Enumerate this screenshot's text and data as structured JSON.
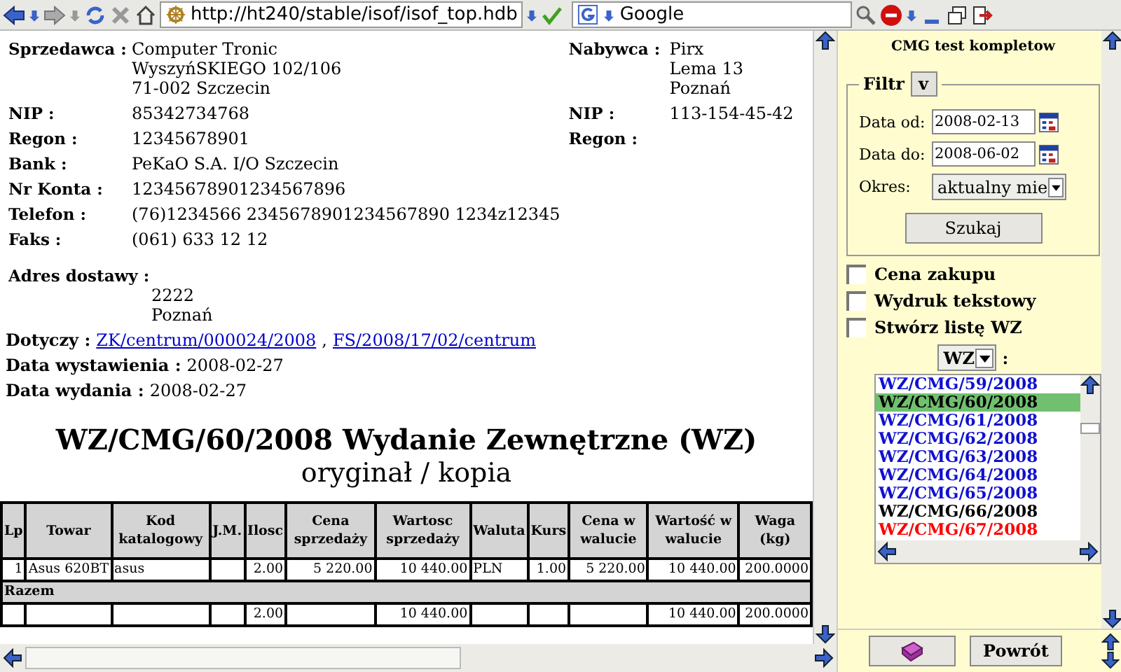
{
  "toolbar": {
    "url": "http://ht240/stable/isof/isof_top.hdb",
    "search": "Google"
  },
  "seller": {
    "label": "Sprzedawca :",
    "lines": [
      "Computer Tronic",
      "WyszyńSKIEGO 102/106",
      "71-002 Szczecin"
    ]
  },
  "buyer": {
    "label": "Nabywca :",
    "lines": [
      "Pirx",
      "Lema 13",
      "Poznań"
    ]
  },
  "seller_details": [
    {
      "label": "NIP :",
      "value": "85342734768"
    },
    {
      "label": "Regon :",
      "value": "12345678901"
    },
    {
      "label": "Bank :",
      "value": "PeKaO S.A. I/O Szczecin"
    },
    {
      "label": "Nr Konta :",
      "value": "12345678901234567896"
    },
    {
      "label": "Telefon :",
      "value": "(76)1234566 2345678901234567890 1234z12345"
    },
    {
      "label": "Faks :",
      "value": "(061) 633 12 12"
    }
  ],
  "buyer_details": [
    {
      "label": "NIP :",
      "value": "113-154-45-42"
    },
    {
      "label": "Regon :"
    }
  ],
  "delivery": {
    "label": "Adres dostawy :",
    "lines": [
      "2222",
      "Poznań"
    ]
  },
  "related": {
    "label": "Dotyczy :",
    "links": [
      "ZK/centrum/000024/2008",
      "FS/2008/17/02/centrum"
    ],
    "separator": ","
  },
  "dates": [
    {
      "label": "Data wystawienia :",
      "value": "2008-02-27"
    },
    {
      "label": "Data wydania :",
      "value": "2008-02-27"
    }
  ],
  "title": "WZ/CMG/60/2008 Wydanie Zewnętrzne (WZ)",
  "subtitle": "oryginał / kopia",
  "table": {
    "columns": [
      "Lp",
      "Towar",
      "Kod katalogowy",
      "J.M.",
      "Ilosc",
      "Cena sprzedaży",
      "Wartosc sprzedaży",
      "Waluta",
      "Kurs",
      "Cena w walucie",
      "Wartość w walucie",
      "Waga (kg)"
    ],
    "rows": [
      [
        "1",
        "Asus 620BT",
        "asus",
        "",
        "2.00",
        "5 220.00",
        "10 440.00",
        "PLN",
        "1.00",
        "5 220.00",
        "10 440.00",
        "200.0000"
      ]
    ],
    "total_label": "Razem",
    "total": {
      "quantity": "2.00",
      "sale_value": "10 440.00",
      "currency_value": "10 440.00",
      "weight": "200.0000"
    }
  },
  "sidebar": {
    "title": "CMG test kompletow",
    "filter": {
      "legend": "Filtr",
      "toggle": "v",
      "date_from": {
        "label": "Data od:",
        "value": "2008-02-13"
      },
      "date_to": {
        "label": "Data do:",
        "value": "2008-06-02"
      },
      "period": {
        "label": "Okres:",
        "value": "aktualny mie"
      },
      "search_button": "Szukaj"
    },
    "checkboxes": [
      {
        "label": "Cena zakupu",
        "checked": false
      },
      {
        "label": "Wydruk tekstowy",
        "checked": false
      },
      {
        "label": "Stwórz listę WZ",
        "checked": false
      }
    ],
    "doc_type": {
      "value": "WZ",
      "suffix": ":"
    },
    "documents": [
      {
        "label": "WZ/CMG/59/2008",
        "color": "#1010d0",
        "selected": false
      },
      {
        "label": "WZ/CMG/60/2008",
        "selected": true
      },
      {
        "label": "WZ/CMG/61/2008",
        "color": "#1010d0",
        "selected": false
      },
      {
        "label": "WZ/CMG/62/2008",
        "color": "#1010d0",
        "selected": false
      },
      {
        "label": "WZ/CMG/63/2008",
        "color": "#1010d0",
        "selected": false
      },
      {
        "label": "WZ/CMG/64/2008",
        "color": "#1010d0",
        "selected": false
      },
      {
        "label": "WZ/CMG/65/2008",
        "color": "#1010d0",
        "selected": false
      },
      {
        "label": "WZ/CMG/66/2008",
        "color": "#000000",
        "selected": false
      },
      {
        "label": "WZ/CMG/67/2008",
        "color": "#ff0000",
        "selected": false
      }
    ],
    "back_button": "Powrót"
  }
}
